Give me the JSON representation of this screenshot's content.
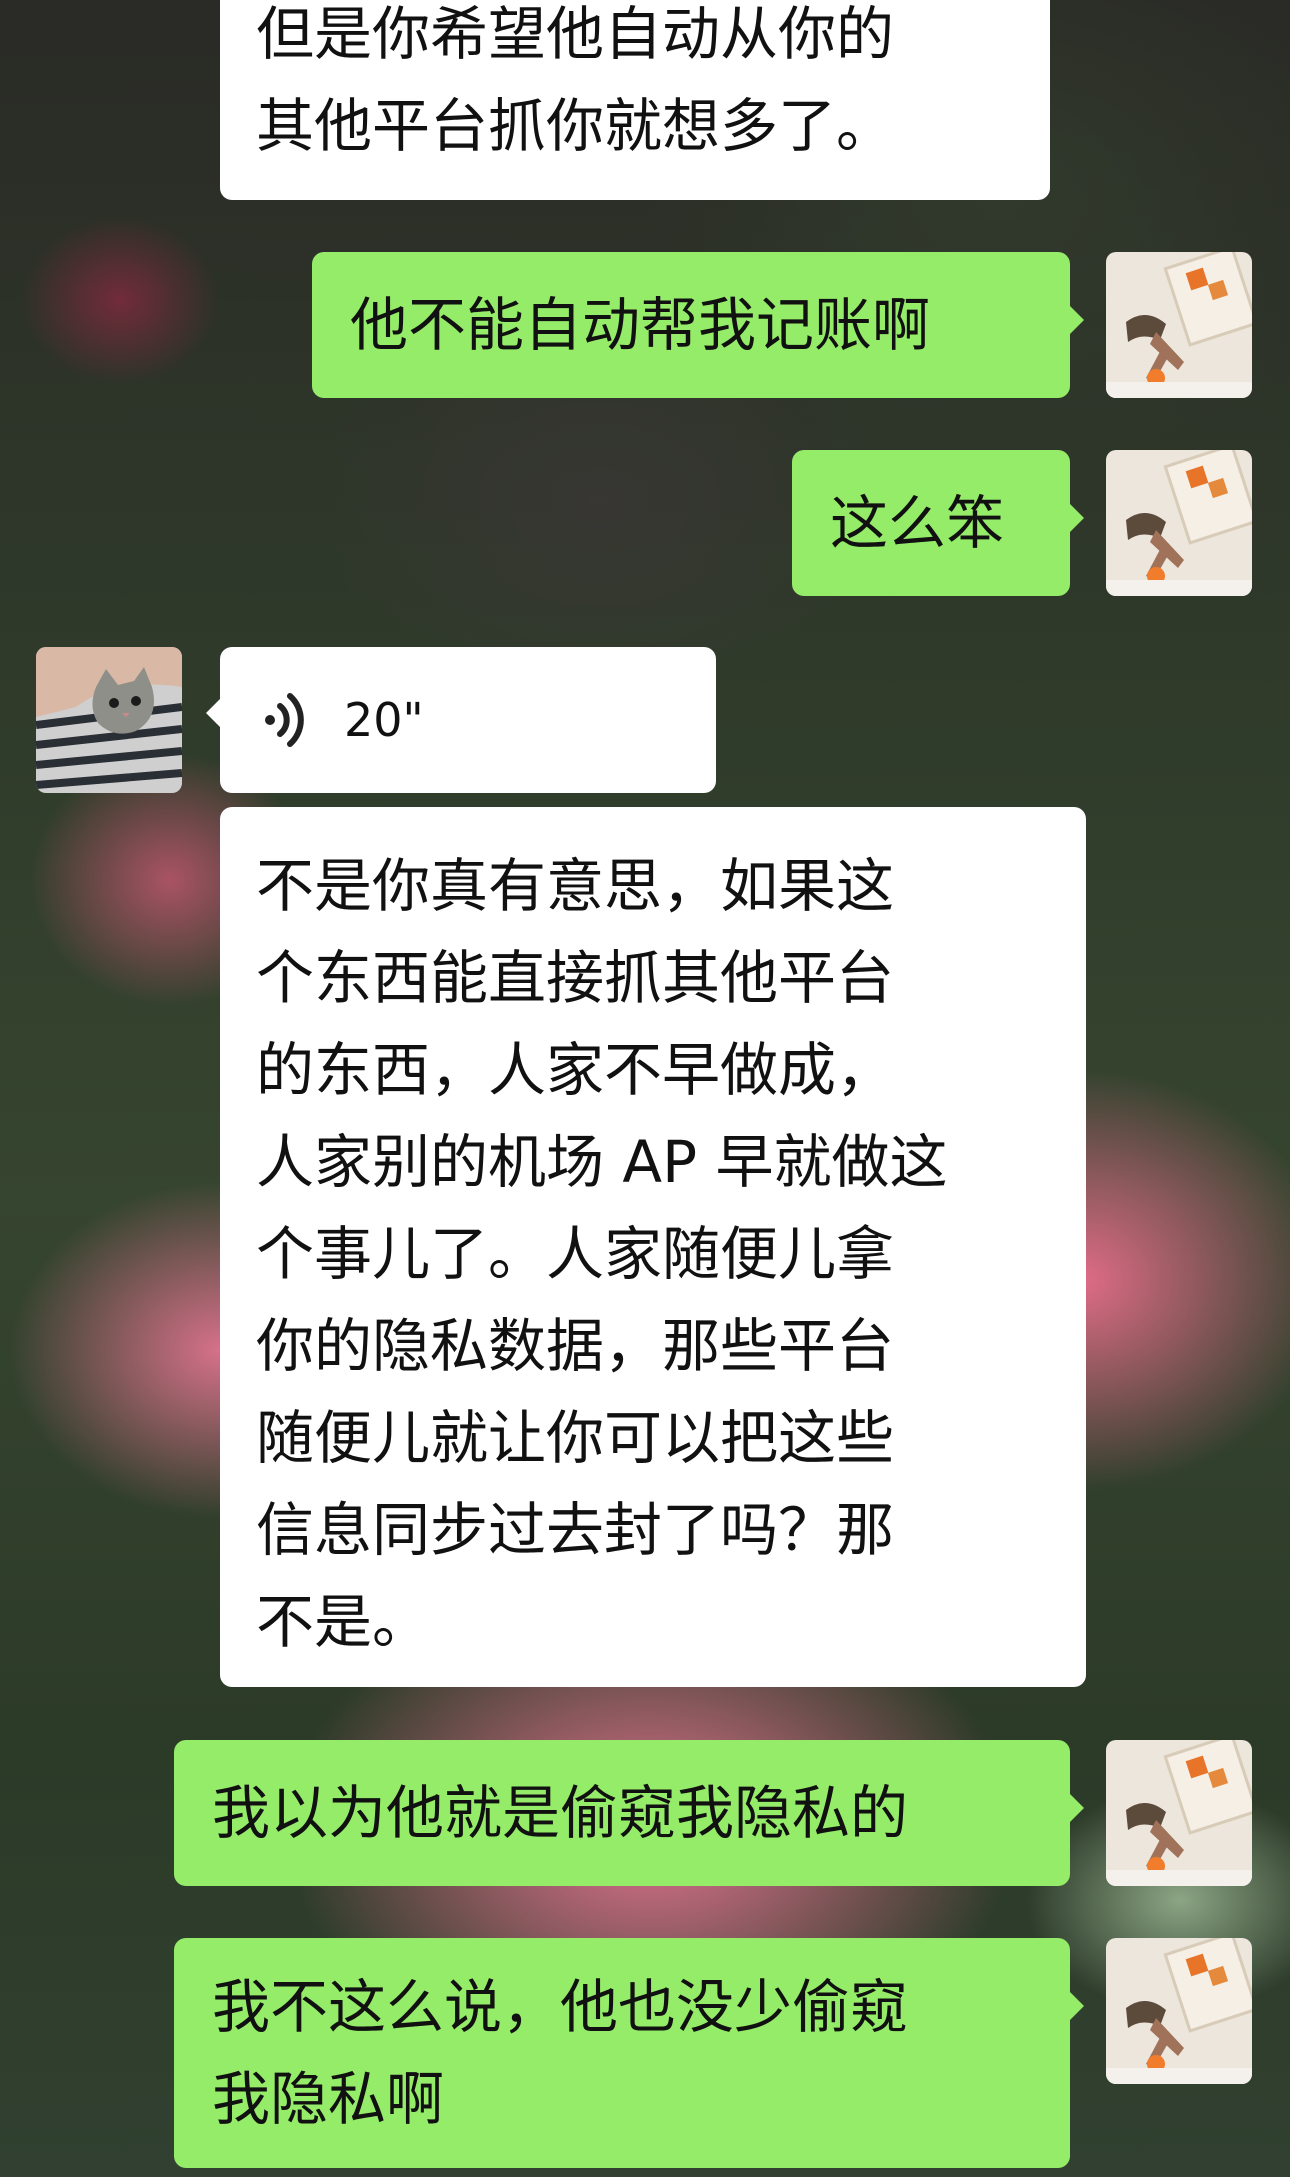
{
  "messages": [
    {
      "id": "m1",
      "side": "received",
      "text": "但是你希望他自动从你的\n其他平台抓你就想多了。"
    },
    {
      "id": "m2",
      "side": "sent",
      "text": "他不能自动帮我记账啊"
    },
    {
      "id": "m3",
      "side": "sent",
      "text": "这么笨"
    },
    {
      "id": "m4",
      "side": "received",
      "type": "voice",
      "duration": "20\""
    },
    {
      "id": "m5",
      "side": "received",
      "text": "不是你真有意思，如果这\n个东西能直接抓其他平台\n的东西，人家不早做成，\n人家别的机场 AP 早就做这\n个事儿了。人家随便儿拿\n你的隐私数据，那些平台\n随便儿就让你可以把这些\n信息同步过去封了吗？那\n不是。"
    },
    {
      "id": "m6",
      "side": "sent",
      "text": "我以为他就是偷窥我隐私的"
    },
    {
      "id": "m7",
      "side": "sent",
      "text": "我不这么说，他也没少偷窥\n我隐私啊"
    }
  ],
  "colors": {
    "sent_bubble": "#95ec69",
    "received_bubble": "#ffffff",
    "text": "#111111"
  },
  "icons": {
    "voice": "voice-wave-icon",
    "self_avatar": "self-avatar",
    "contact_avatar": "contact-avatar-cat"
  }
}
